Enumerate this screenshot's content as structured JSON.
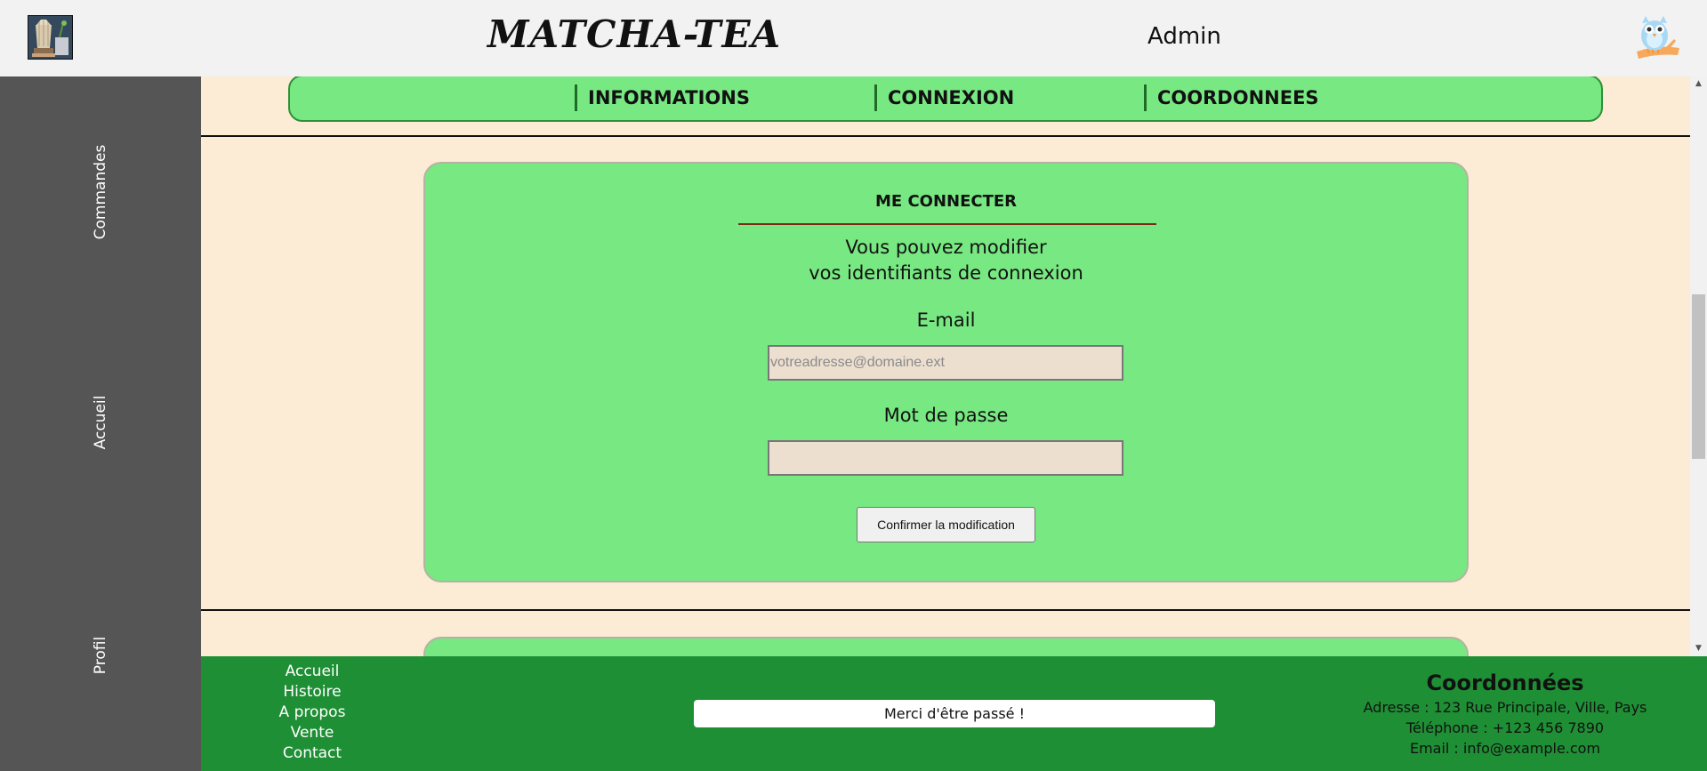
{
  "header": {
    "brand": "MATCHA-TEA",
    "user": "Admin"
  },
  "sidebar": {
    "items": [
      {
        "label": "Commandes"
      },
      {
        "label": "Accueil"
      },
      {
        "label": "Profil"
      }
    ]
  },
  "tabs": [
    {
      "label": "INFORMATIONS"
    },
    {
      "label": "CONNEXION"
    },
    {
      "label": "COORDONNEES"
    }
  ],
  "login_card": {
    "title": "ME CONNECTER",
    "description_line1": "Vous pouvez modifier",
    "description_line2": "vos identifiants de connexion",
    "email_label": "E-mail",
    "email_placeholder": "votreadresse@domaine.ext",
    "email_value": "",
    "password_label": "Mot de passe",
    "password_value": "",
    "confirm_label": "Confirmer la modification"
  },
  "footer": {
    "links": [
      {
        "label": "Accueil"
      },
      {
        "label": "Histoire"
      },
      {
        "label": "A propos"
      },
      {
        "label": "Vente"
      },
      {
        "label": "Contact"
      }
    ],
    "thanks": "Merci d'être passé !",
    "contact": {
      "title": "Coordonnées",
      "address": "Adresse : 123 Rue Principale, Ville, Pays",
      "phone": "Téléphone : +123 456 7890",
      "email": "Email : info@example.com"
    }
  },
  "icons": {
    "logo": "matcha-whisk-logo-icon",
    "avatar": "owl-avatar-icon",
    "scroll_up": "chevron-up-icon",
    "scroll_down": "chevron-down-icon"
  },
  "colors": {
    "header_bg": "#f2f2f2",
    "sidebar_bg": "#555555",
    "content_bg": "#fcebd5",
    "card_green": "#78e882",
    "footer_green": "#1f8f35",
    "input_bg": "#ecdfcf",
    "title_rule": "#7a2b18"
  }
}
